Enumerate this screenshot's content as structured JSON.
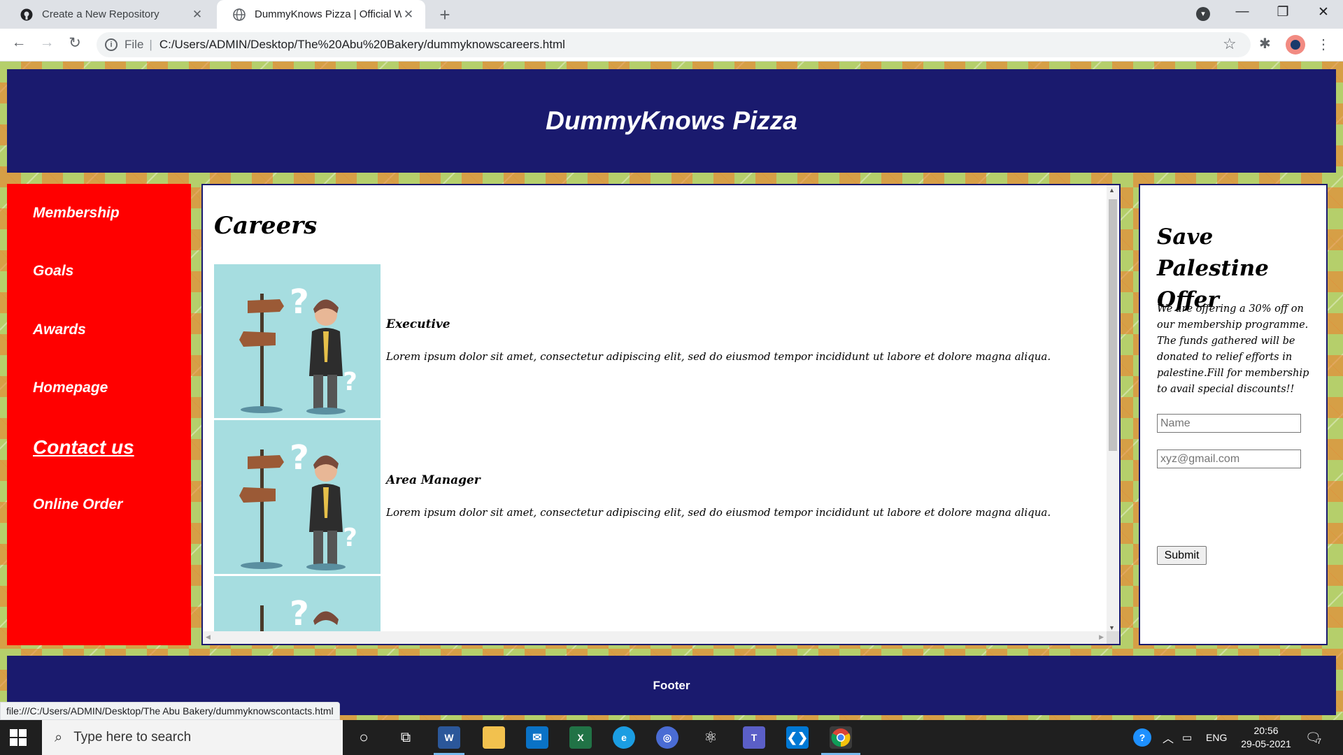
{
  "browser": {
    "tabs": [
      {
        "title": "Create a New Repository",
        "favicon": "github-icon",
        "active": false
      },
      {
        "title": "DummyKnows Pizza | Official Website",
        "favicon": "globe-icon",
        "active": true
      }
    ],
    "address": {
      "scheme": "File",
      "url": "C:/Users/ADMIN/Desktop/The%20Abu%20Bakery/dummyknowscareers.html"
    },
    "status_url": "file:///C:/Users/ADMIN/Desktop/The Abu Bakery/dummyknowscontacts.html"
  },
  "site": {
    "title": "DummyKnows Pizza",
    "nav": [
      "Membership",
      "Goals",
      "Awards",
      "Homepage",
      "Contact us",
      "Online Order"
    ],
    "careers_title": "Careers",
    "jobs": [
      {
        "title": "Executive",
        "desc": "Lorem ipsum dolor sit amet, consectetur adipiscing elit, sed do eiusmod tempor incididunt ut labore et dolore magna aliqua."
      },
      {
        "title": "Area Manager",
        "desc": "Lorem ipsum dolor sit amet, consectetur adipiscing elit, sed do eiusmod tempor incididunt ut labore et dolore magna aliqua."
      }
    ],
    "offer": {
      "title": "Save Palestine Offer",
      "text": "We are offering a 30% off on our membership programme. The funds gathered will be donated to relief efforts in palestine.Fill for membership to avail special discounts!!",
      "name_placeholder": "Name",
      "email_placeholder": "xyz@gmail.com",
      "submit_label": "Submit"
    },
    "footer": "Footer"
  },
  "taskbar": {
    "search_placeholder": "Type here to search",
    "language": "ENG",
    "time": "20:56",
    "date": "29-05-2021",
    "notification_count": "7"
  },
  "colors": {
    "header_bg": "#1a1a6e",
    "nav_bg": "#ff0000",
    "page_pattern": "#b5cf6b"
  }
}
